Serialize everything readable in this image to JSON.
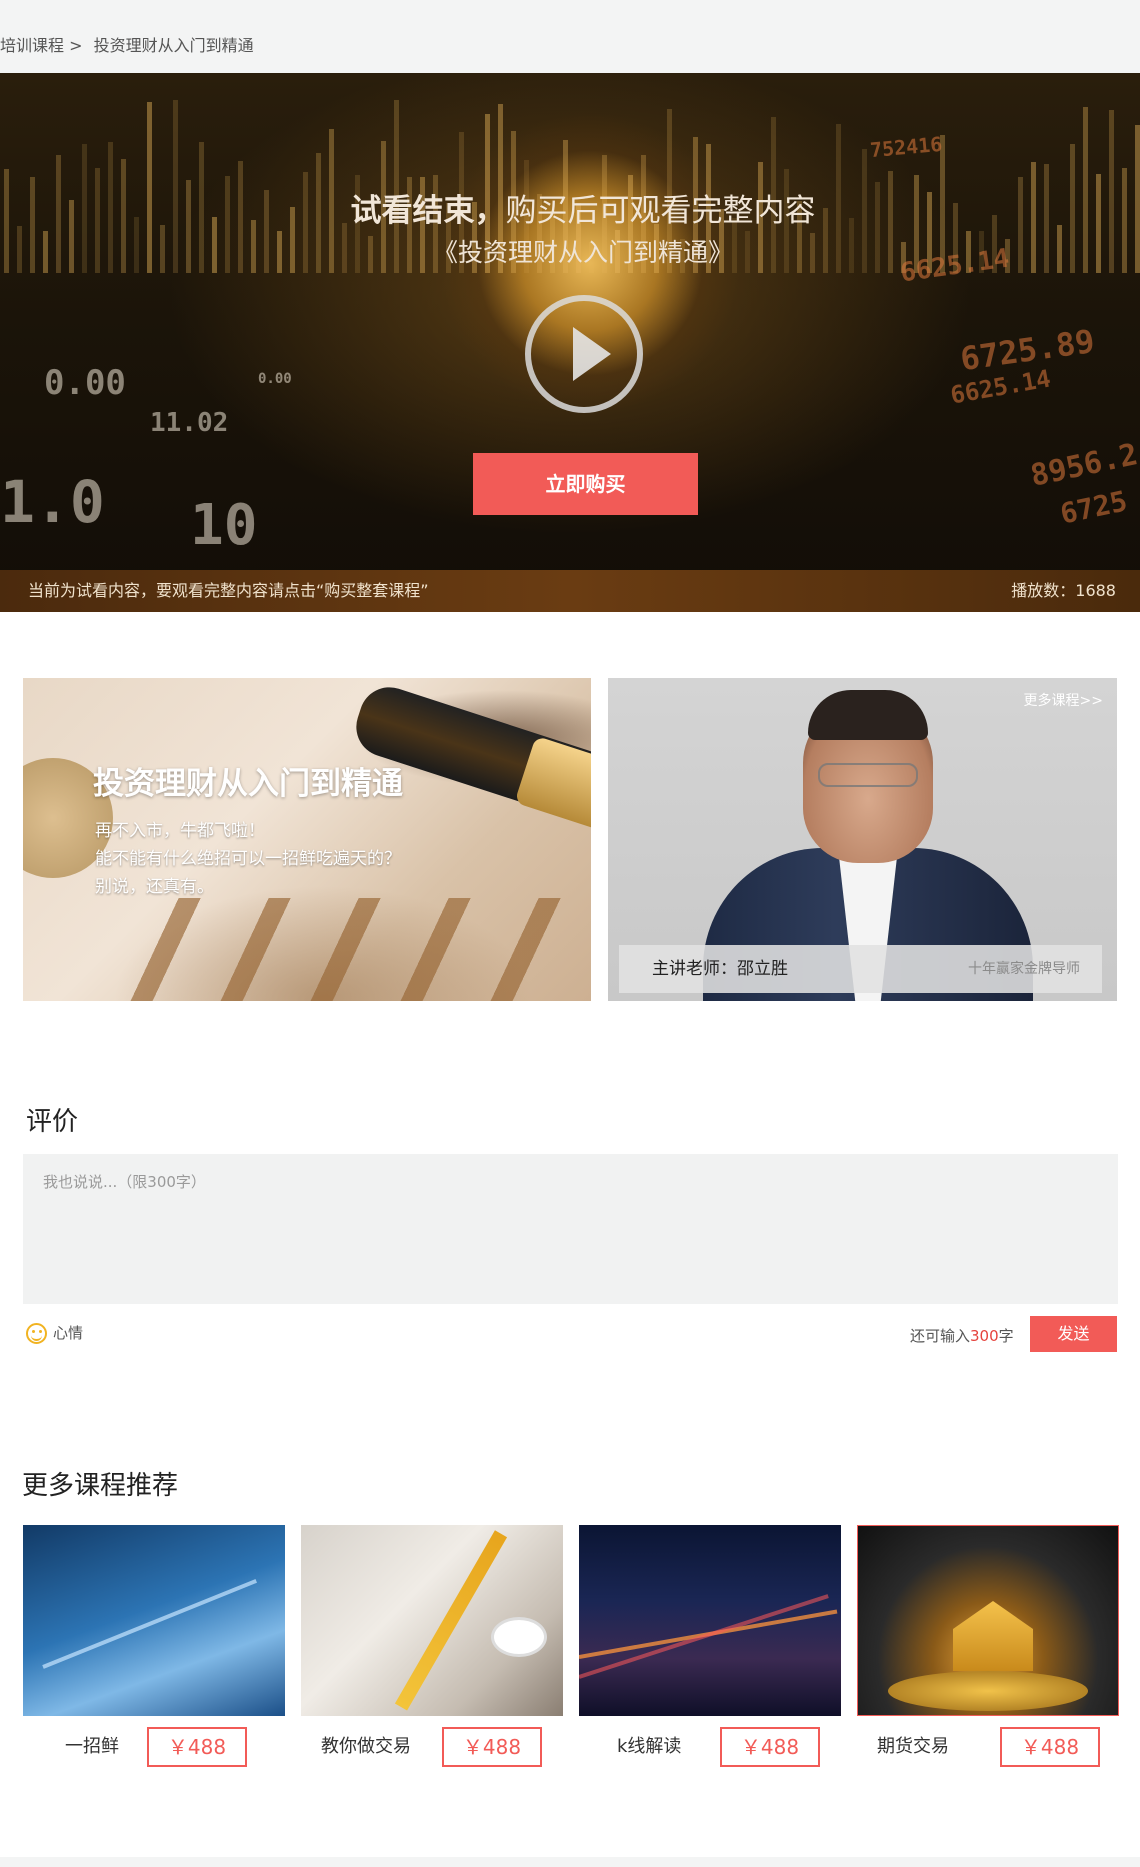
{
  "breadcrumb": {
    "parent": "培训课程 >",
    "current": "投资理财从入门到精通"
  },
  "hero": {
    "title_bold": "试看结束，",
    "title_rest": "购买后可观看完整内容",
    "subtitle": "《投资理财从入门到精通》",
    "buy_button": "立即购买",
    "notice": "当前为试看内容，要观看完整内容请点击“购买整套课程”",
    "play_count": "播放数：1688",
    "bg_numbers": [
      "0.00",
      "11.02",
      "1.0",
      "10",
      "0.00",
      "6725.89",
      "6625.14",
      "8956.2",
      "6725",
      "752416",
      "6625.14"
    ]
  },
  "course": {
    "title": "投资理财从入门到精通",
    "lines": [
      "再不入市，牛都飞啦！",
      "能不能有什么绝招可以一招鲜吃遍天的？",
      "别说，还真有。"
    ]
  },
  "teacher": {
    "more_link": "更多课程>>",
    "label": "主讲老师：邵立胜",
    "subtitle": "十年赢家金牌导师"
  },
  "review": {
    "title": "评价",
    "placeholder": "我也说说...（限300字）",
    "mood_label": "心情",
    "remain_prefix": "还可输入",
    "remain_count": "300",
    "remain_suffix": "字",
    "send_button": "发送"
  },
  "recommend": {
    "title": "更多课程推荐",
    "items": [
      {
        "name": "一招鲜",
        "price": "￥488"
      },
      {
        "name": "教你做交易",
        "price": "￥488"
      },
      {
        "name": "k线解读",
        "price": "￥488"
      },
      {
        "name": "期货交易",
        "price": "￥488"
      }
    ]
  },
  "colors": {
    "accent": "#f25b57",
    "breadcrumb_bg": "#f3f4f4",
    "mood_icon": "#f1b321"
  }
}
